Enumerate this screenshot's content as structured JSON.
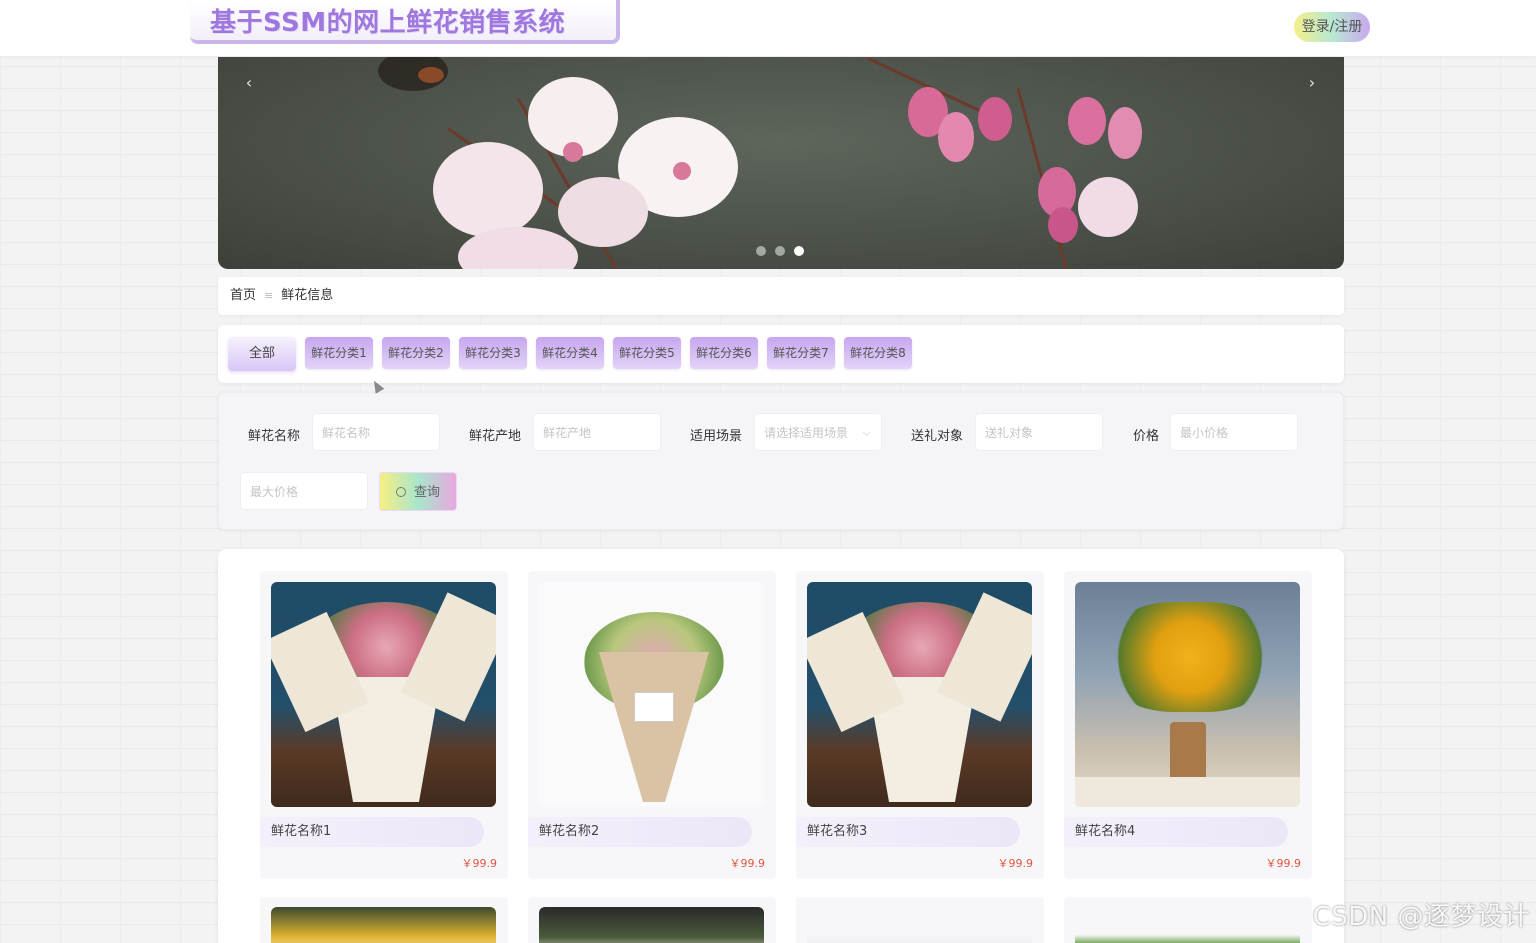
{
  "header": {
    "site_title": "基于SSM的网上鲜花销售系统",
    "login_label": "登录/注册"
  },
  "banner": {
    "prev_icon": "‹",
    "next_icon": "›",
    "slide_count": 3,
    "active_slide": 3
  },
  "breadcrumb": {
    "home": "首页",
    "separator": "≡",
    "current": "鲜花信息"
  },
  "categories": {
    "all": "全部",
    "items": [
      "鲜花分类1",
      "鲜花分类2",
      "鲜花分类3",
      "鲜花分类4",
      "鲜花分类5",
      "鲜花分类6",
      "鲜花分类7",
      "鲜花分类8"
    ]
  },
  "filter": {
    "name_label": "鲜花名称",
    "name_placeholder": "鲜花名称",
    "origin_label": "鲜花产地",
    "origin_placeholder": "鲜花产地",
    "scene_label": "适用场景",
    "scene_placeholder": "请选择适用场景",
    "recipient_label": "送礼对象",
    "recipient_placeholder": "送礼对象",
    "price_label": "价格",
    "min_price_placeholder": "最小价格",
    "max_price_placeholder": "最大价格",
    "search_label": "查询",
    "search_icon": "search-icon"
  },
  "products": [
    {
      "name": "鲜花名称1",
      "price": "￥99.9"
    },
    {
      "name": "鲜花名称2",
      "price": "￥99.9"
    },
    {
      "name": "鲜花名称3",
      "price": "￥99.9"
    },
    {
      "name": "鲜花名称4",
      "price": "￥99.9"
    }
  ],
  "watermark": "CSDN @逐梦设计",
  "colors": {
    "accent_purple": "#9e78de",
    "price_red": "#e0563f"
  }
}
